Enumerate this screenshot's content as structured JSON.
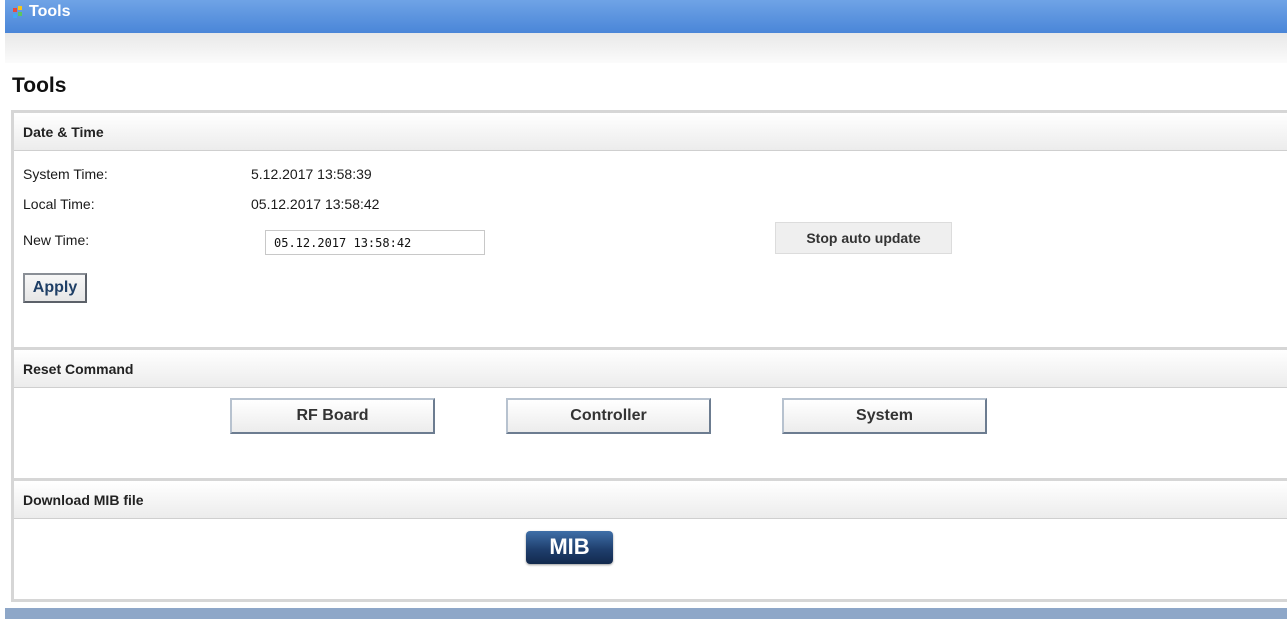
{
  "window": {
    "title": "Tools"
  },
  "page": {
    "title": "Tools"
  },
  "date_time": {
    "header": "Date & Time",
    "system_time_label": "System Time:",
    "system_time_value": "5.12.2017 13:58:39",
    "local_time_label": "Local Time:",
    "local_time_value": "05.12.2017 13:58:42",
    "new_time_label": "New Time:",
    "new_time_value": "05.12.2017 13:58:42",
    "stop_button": "Stop auto update",
    "apply_button": "Apply"
  },
  "reset": {
    "header": "Reset Command",
    "buttons": [
      "RF Board",
      "Controller",
      "System"
    ]
  },
  "mib": {
    "header": "Download MIB file",
    "button": "MIB"
  },
  "colors": {
    "titlebar": "#4a86d8",
    "mib_button": "#1f3f6e"
  }
}
